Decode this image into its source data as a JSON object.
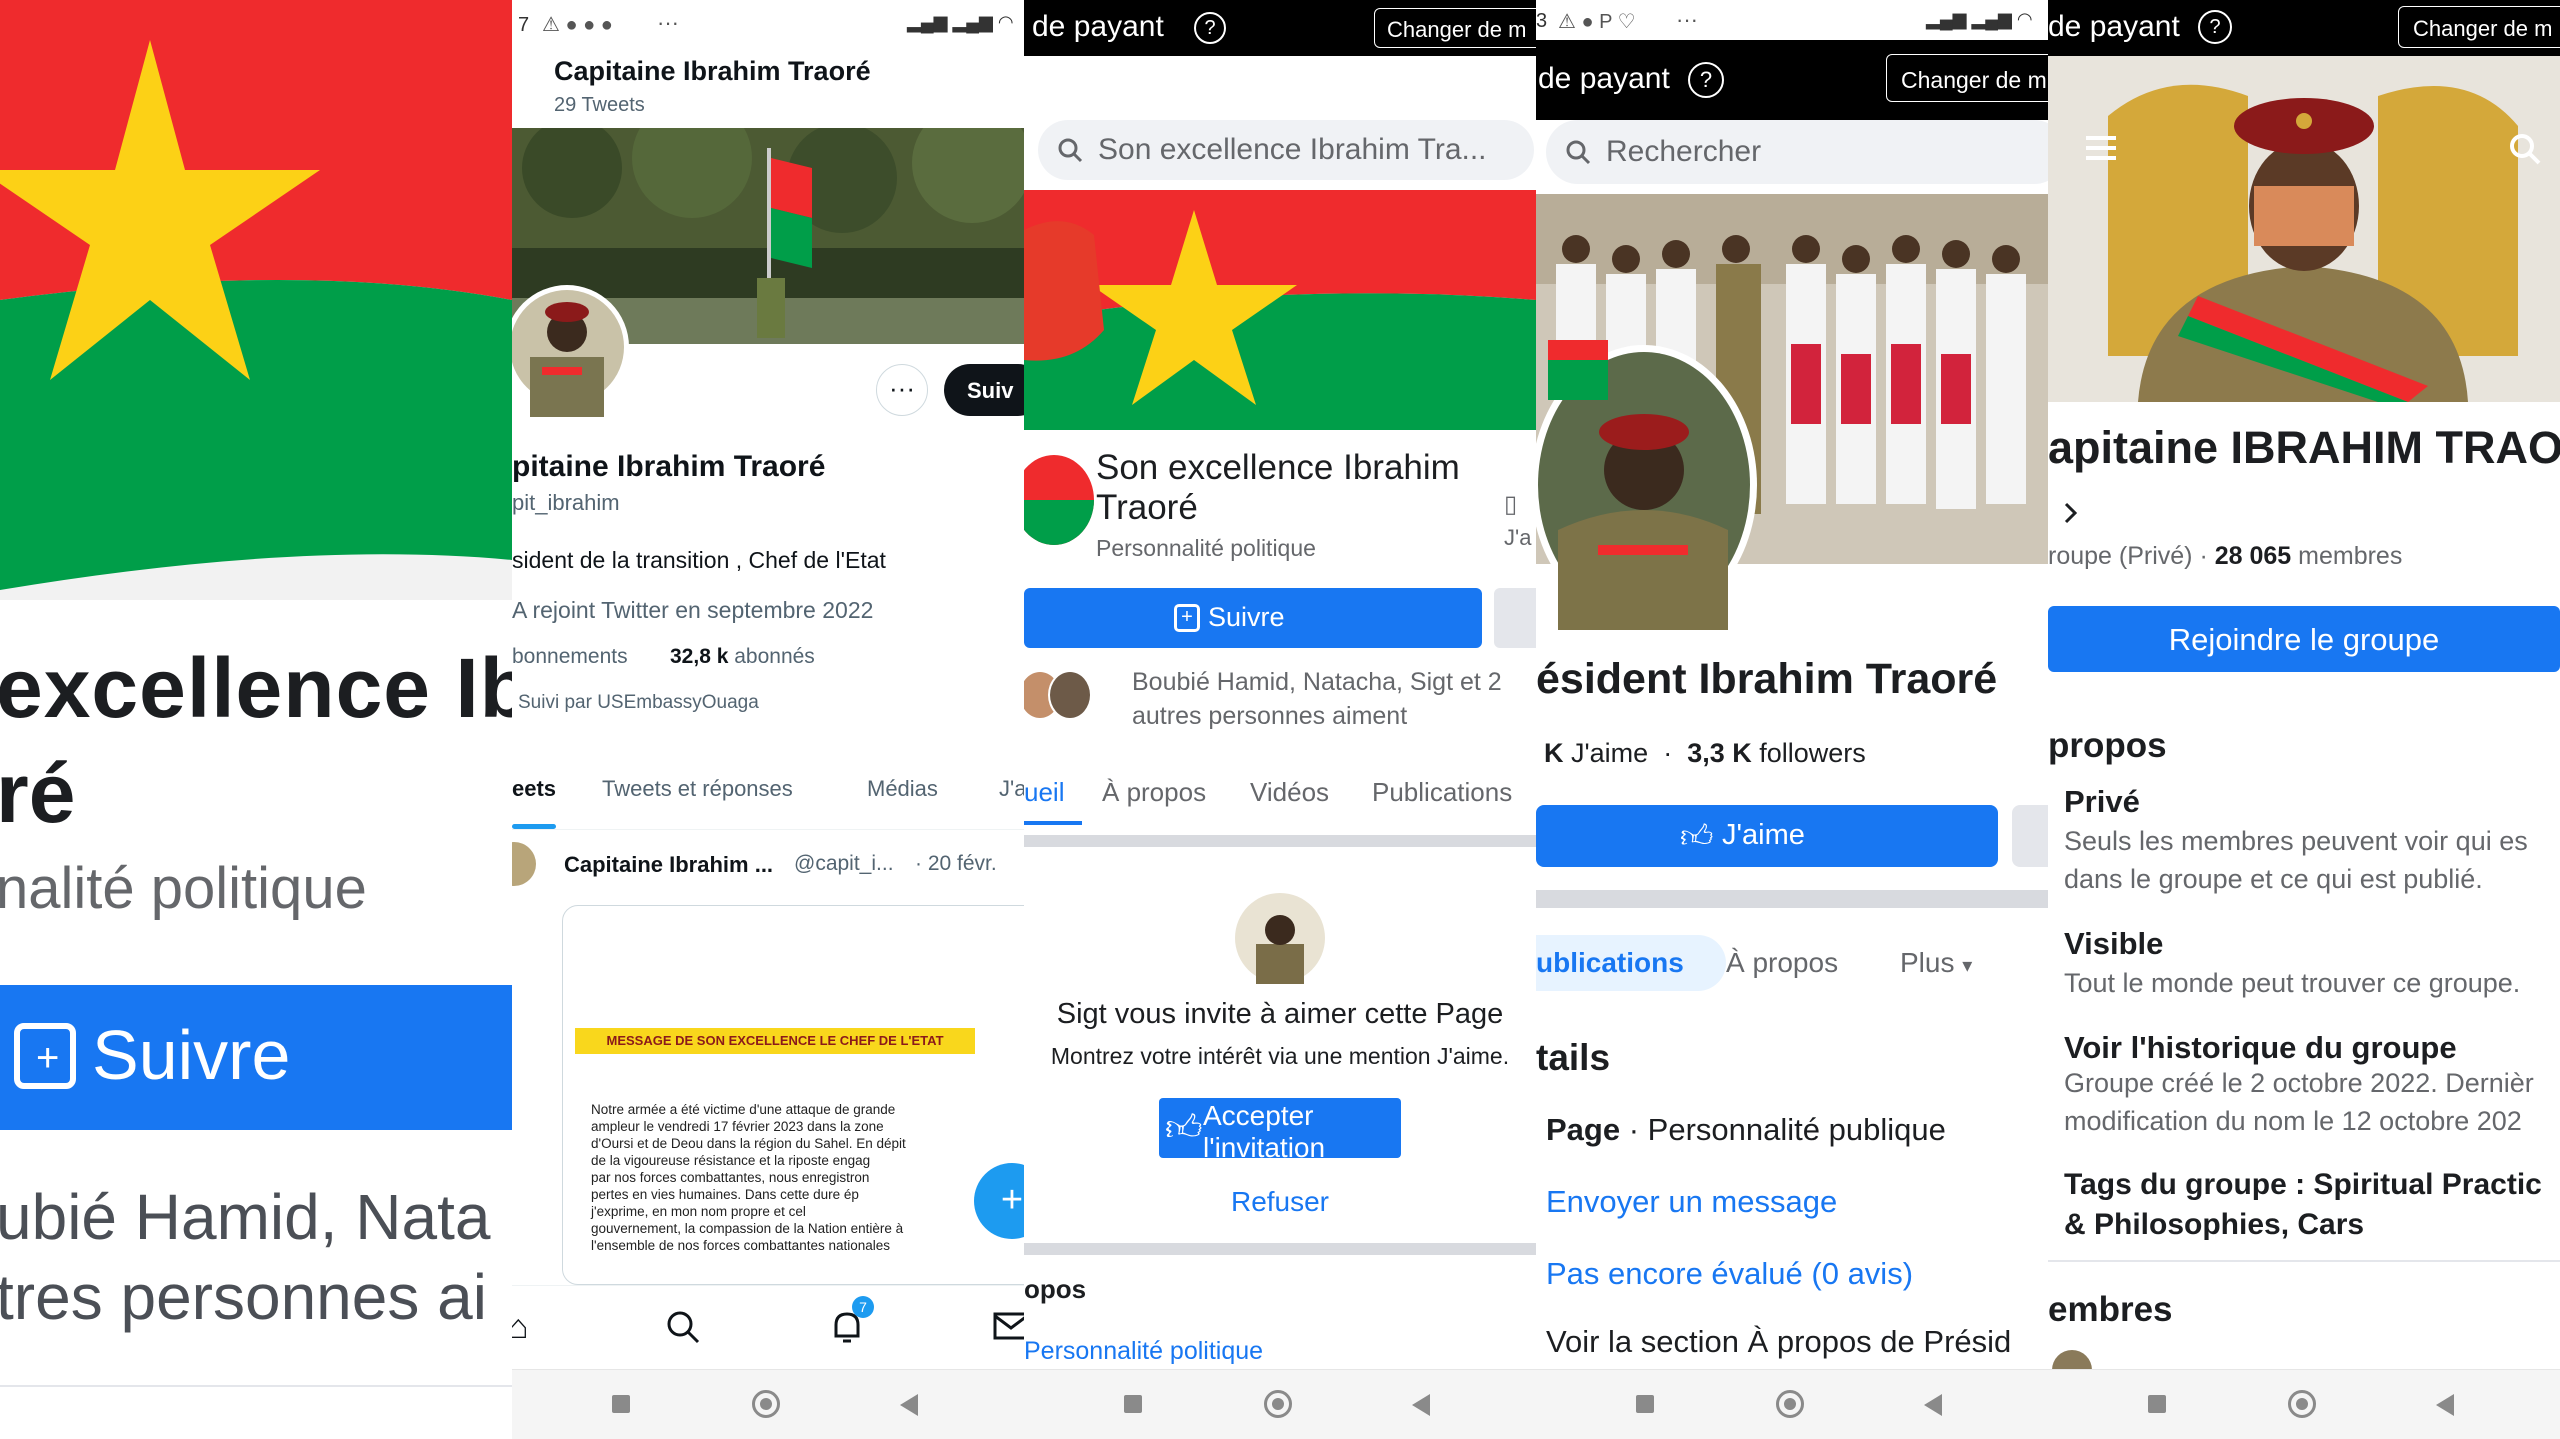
{
  "colors": {
    "fb_blue": "#1877f2",
    "flag_red": "#ef2b2d",
    "flag_green": "#009e49",
    "flag_yellow": "#fcd116",
    "twitter_black": "#0f1419"
  },
  "p1": {
    "title_line1": "excellence  Ib",
    "title_line2": "ré",
    "subtitle": "nalité politique",
    "follow_label": "Suivre",
    "likes_line1": "ubié Hamid, Nata",
    "likes_line2": "tres personnes ai"
  },
  "p2": {
    "status_left": "7",
    "status_dots": "···",
    "header_name": "Capitaine Ibrahim Traoré",
    "header_count": "29 Tweets",
    "follow_label": "Suiv",
    "name": "pitaine Ibrahim Traoré",
    "handle": "pit_ibrahim",
    "bio": "sident de la transition , Chef de l'Etat",
    "joined": "A rejoint Twitter en septembre 2022",
    "following_label": "bonnements",
    "followers_count": "32,8 k",
    "followers_label": "abonnés",
    "followed_by": "Suivi par USEmbassyOuaga",
    "tabs": [
      "eets",
      "Tweets et réponses",
      "Médias",
      "J'a"
    ],
    "tweet_author": "Capitaine Ibrahim ...",
    "tweet_handle": "@capit_i...",
    "tweet_date": "· 20 févr.",
    "doc_header": "MESSAGE DE SON EXCELLENCE LE CHEF DE L'ETAT",
    "doc_lines": [
      "Notre armée a été victime d'une attaque de grande",
      "ampleur le vendredi 17 février 2023 dans la zone",
      "d'Oursi et de Deou dans la région du Sahel. En dépit",
      "de la vigoureuse résistance et la riposte engag",
      "par nos forces combattantes, nous enregistron",
      "pertes en vies humaines. Dans cette dure ép",
      "j'exprime, en mon nom propre et cel",
      "gouvernement, la compassion de la Nation entière à",
      "l'ensemble de nos forces combattantes nationales"
    ],
    "notif_badge": "7"
  },
  "p3": {
    "topbar_text": "de payant",
    "topbar_btn": "Changer de m",
    "search_text": "Son excellence  Ibrahim Tra...",
    "page_title_line1": "Son excellence  Ibrahim",
    "page_title_line2": "Traoré",
    "page_category": "Personnalité politique",
    "page_side": "J'a",
    "follow_label": "Suivre",
    "likes_line1": "Boubié Hamid, Natacha, Sigt et 2",
    "likes_line2": "autres personnes aiment",
    "tabs": [
      "ueil",
      "À propos",
      "Vidéos",
      "Publications"
    ],
    "invite_title": "Sigt vous invite à aimer cette Page",
    "invite_sub": "Montrez votre intérêt via une mention J'aime.",
    "accept_label": "Accepter l'invitation",
    "refuse_label": "Refuser",
    "about_heading": "opos",
    "about_value": "Personnalité politique"
  },
  "p4": {
    "status_left": "3",
    "status_dots": "···",
    "topbar_text": "de payant",
    "topbar_btn": "Changer de m",
    "search_placeholder": "Rechercher",
    "page_name": "ésident Ibrahim Traoré",
    "likes_count": "K",
    "likes_label": "J'aime",
    "followers_count": "3,3 K",
    "followers_label": "followers",
    "like_label": "J'aime",
    "tabs": [
      "ublications",
      "À propos",
      "Plus"
    ],
    "details_heading": "tails",
    "page_label": "Page",
    "page_category": "· Personnalité publique",
    "message_link": "Envoyer un message",
    "rating_link": "Pas encore évalué (0 avis)",
    "about_link": "Voir la section À propos de Présid"
  },
  "p5": {
    "topbar_text": "de payant",
    "topbar_btn": "Changer de m",
    "group_name": "apitaine IBRAHIM TRAOR",
    "group_type": "roupe (Privé)",
    "members_count": "28 065",
    "members_label": "membres",
    "join_label": "Rejoindre le groupe",
    "about_heading": "propos",
    "private_title": "Privé",
    "private_desc_1": "Seuls les membres peuvent voir qui es",
    "private_desc_2": "dans le groupe et ce qui est publié.",
    "visible_title": "Visible",
    "visible_desc": "Tout le monde peut trouver ce groupe.",
    "history_title": "Voir l'historique du groupe",
    "history_desc_1": "Groupe créé le 2 octobre 2022. Dernièr",
    "history_desc_2": "modification du nom le 12 octobre 202",
    "tags_line1": "Tags du groupe : Spiritual Practic",
    "tags_line2": "& Philosophies, Cars",
    "members_heading": "embres"
  }
}
